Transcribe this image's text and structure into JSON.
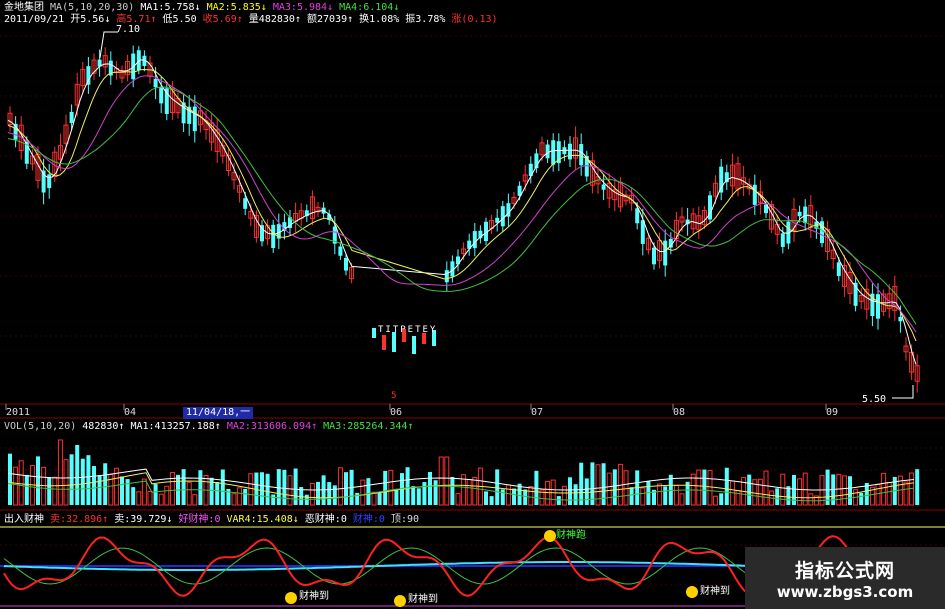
{
  "header": {
    "stock_name": "金地集团",
    "ma_label": "MA(5,10,20,30)",
    "ma1": "MA1:5.758↓",
    "ma2": "MA2:5.835↓",
    "ma3": "MA3:5.984↓",
    "ma4": "MA4:6.104↓",
    "date": "2011/09/21",
    "open": "开5.56↓",
    "high": "高5.71↑",
    "low": "低5.50",
    "close": "收5.69↑",
    "volume": "量482830↑",
    "amount": "额27039↑",
    "turnover": "换1.08%",
    "amplitude": "振3.78%",
    "change": "涨(0.13)"
  },
  "price_chart": {
    "high_label": "7.10",
    "low_label": "5.50",
    "mid_label": "TITPETEY",
    "marker": "5"
  },
  "axis": {
    "labels": [
      "2011",
      "04",
      "06",
      "07",
      "08",
      "09"
    ],
    "cursor_date": "11/04/18,一"
  },
  "vol_panel": {
    "label": "VOL(5,10,20)",
    "value": "482830↑",
    "ma1": "MA1:413257.188↑",
    "ma2": "MA2:313606.094↑",
    "ma3": "MA3:285264.344↑"
  },
  "indicator_panel": {
    "label": "出入财神",
    "sell": "卖:32.896↑",
    "buy": "卖:39.729↓",
    "good": "好财神:0",
    "var4": "VAR4:15.408↓",
    "bad": "恶财神:0",
    "extra": "财神:0",
    "top": "顶:90",
    "signal_top": "财神跑",
    "signal_bottom": "财神到"
  },
  "watermark": {
    "title": "指标公式网",
    "url": "www.zbgs3.com"
  },
  "colors": {
    "up": "#ff3030",
    "down": "#54ffff",
    "ma1": "#ffffff",
    "ma2": "#f0f060",
    "ma3": "#d040d0",
    "ma4": "#40c040",
    "grid": "#8a0000"
  }
}
